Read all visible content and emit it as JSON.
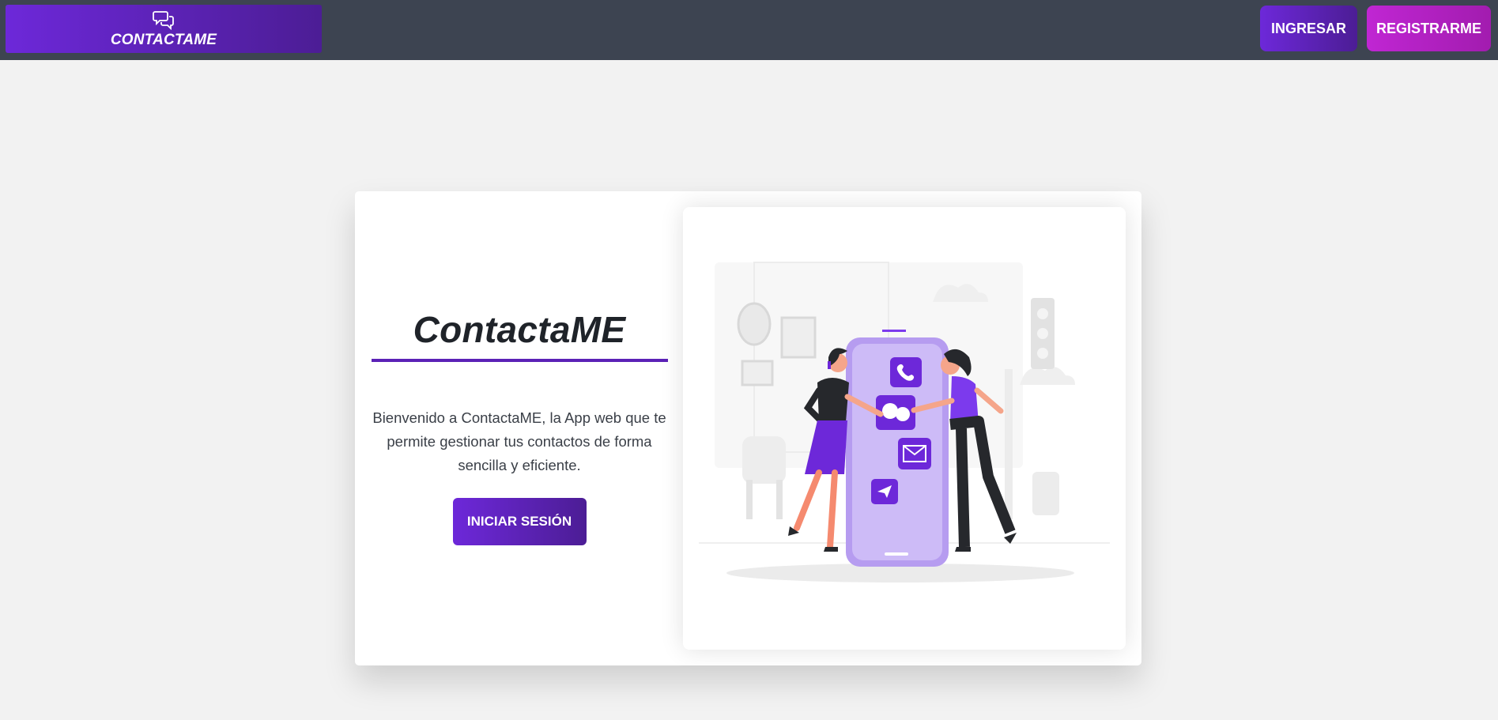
{
  "navbar": {
    "brand": {
      "label": "CONTACTAME",
      "icon": "chat-bubbles-icon"
    },
    "login_label": "INGRESAR",
    "register_label": "REGISTRARME"
  },
  "hero": {
    "title": "ContactaME",
    "description": "Bienvenido a ContactaME, la App web que te permite gestionar tus contactos de forma sencilla y eficiente.",
    "cta_label": "INICIAR SESIÓN"
  },
  "illustration": {
    "icons": [
      "phone-icon",
      "chat-bubbles-icon",
      "mail-icon",
      "paper-plane-icon"
    ]
  },
  "colors": {
    "navbar_bg": "#3d4451",
    "primary": "#6d28d9",
    "secondary": "#c026d3",
    "page_bg": "#f2f2f2",
    "phone": "#c4b1f0"
  }
}
